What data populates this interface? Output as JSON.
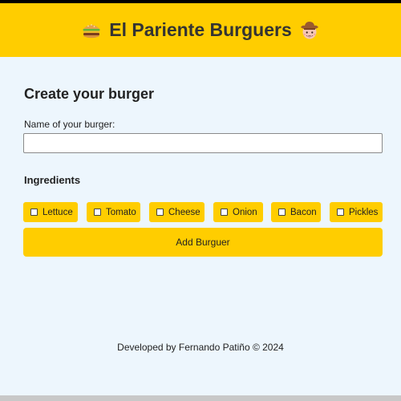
{
  "header": {
    "title": "El Pariente Burguers",
    "left_icon": "burger-icon",
    "right_icon": "cowboy-face-icon",
    "background": "#ffcd00"
  },
  "form": {
    "section_title": "Create your burger",
    "name_label": "Name of your burger:",
    "name_value": "",
    "name_placeholder": "",
    "ingredients_title": "Ingredients",
    "ingredients": [
      {
        "label": "Lettuce",
        "checked": false
      },
      {
        "label": "Tomato",
        "checked": false
      },
      {
        "label": "Cheese",
        "checked": false
      },
      {
        "label": "Onion",
        "checked": false
      },
      {
        "label": "Bacon",
        "checked": false
      },
      {
        "label": "Pickles",
        "checked": false
      }
    ],
    "add_button_label": "Add Burguer"
  },
  "footer": {
    "text": "Developed by Fernando Patiño © 2024"
  },
  "colors": {
    "accent": "#ffcd00",
    "page_background": "#edf6fd"
  }
}
